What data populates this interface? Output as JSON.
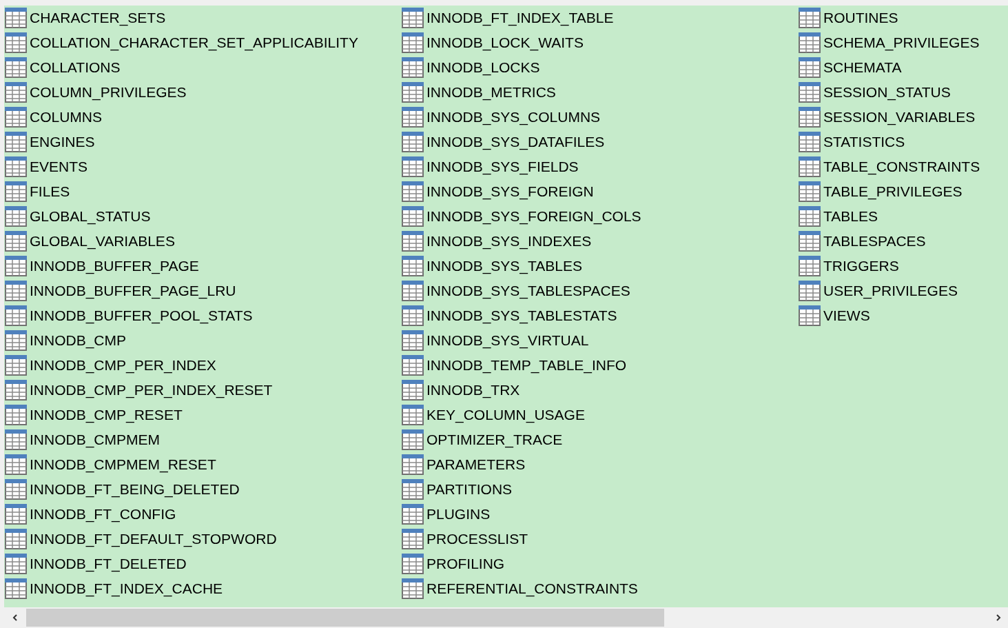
{
  "tables": [
    {
      "name": "CHARACTER_SETS"
    },
    {
      "name": "COLLATION_CHARACTER_SET_APPLICABILITY"
    },
    {
      "name": "COLLATIONS"
    },
    {
      "name": "COLUMN_PRIVILEGES"
    },
    {
      "name": "COLUMNS"
    },
    {
      "name": "ENGINES"
    },
    {
      "name": "EVENTS"
    },
    {
      "name": "FILES"
    },
    {
      "name": "GLOBAL_STATUS"
    },
    {
      "name": "GLOBAL_VARIABLES"
    },
    {
      "name": "INNODB_BUFFER_PAGE"
    },
    {
      "name": "INNODB_BUFFER_PAGE_LRU"
    },
    {
      "name": "INNODB_BUFFER_POOL_STATS"
    },
    {
      "name": "INNODB_CMP"
    },
    {
      "name": "INNODB_CMP_PER_INDEX"
    },
    {
      "name": "INNODB_CMP_PER_INDEX_RESET"
    },
    {
      "name": "INNODB_CMP_RESET"
    },
    {
      "name": "INNODB_CMPMEM"
    },
    {
      "name": "INNODB_CMPMEM_RESET"
    },
    {
      "name": "INNODB_FT_BEING_DELETED"
    },
    {
      "name": "INNODB_FT_CONFIG"
    },
    {
      "name": "INNODB_FT_DEFAULT_STOPWORD"
    },
    {
      "name": "INNODB_FT_DELETED"
    },
    {
      "name": "INNODB_FT_INDEX_CACHE"
    },
    {
      "name": "INNODB_FT_INDEX_TABLE"
    },
    {
      "name": "INNODB_LOCK_WAITS"
    },
    {
      "name": "INNODB_LOCKS"
    },
    {
      "name": "INNODB_METRICS"
    },
    {
      "name": "INNODB_SYS_COLUMNS"
    },
    {
      "name": "INNODB_SYS_DATAFILES"
    },
    {
      "name": "INNODB_SYS_FIELDS"
    },
    {
      "name": "INNODB_SYS_FOREIGN"
    },
    {
      "name": "INNODB_SYS_FOREIGN_COLS"
    },
    {
      "name": "INNODB_SYS_INDEXES"
    },
    {
      "name": "INNODB_SYS_TABLES"
    },
    {
      "name": "INNODB_SYS_TABLESPACES"
    },
    {
      "name": "INNODB_SYS_TABLESTATS"
    },
    {
      "name": "INNODB_SYS_VIRTUAL"
    },
    {
      "name": "INNODB_TEMP_TABLE_INFO"
    },
    {
      "name": "INNODB_TRX"
    },
    {
      "name": "KEY_COLUMN_USAGE"
    },
    {
      "name": "OPTIMIZER_TRACE"
    },
    {
      "name": "PARAMETERS"
    },
    {
      "name": "PARTITIONS"
    },
    {
      "name": "PLUGINS"
    },
    {
      "name": "PROCESSLIST"
    },
    {
      "name": "PROFILING"
    },
    {
      "name": "REFERENTIAL_CONSTRAINTS"
    },
    {
      "name": "ROUTINES"
    },
    {
      "name": "SCHEMA_PRIVILEGES"
    },
    {
      "name": "SCHEMATA"
    },
    {
      "name": "SESSION_STATUS"
    },
    {
      "name": "SESSION_VARIABLES"
    },
    {
      "name": "STATISTICS"
    },
    {
      "name": "TABLE_CONSTRAINTS"
    },
    {
      "name": "TABLE_PRIVILEGES"
    },
    {
      "name": "TABLES"
    },
    {
      "name": "TABLESPACES"
    },
    {
      "name": "TRIGGERS"
    },
    {
      "name": "USER_PRIVILEGES"
    },
    {
      "name": "VIEWS"
    }
  ]
}
